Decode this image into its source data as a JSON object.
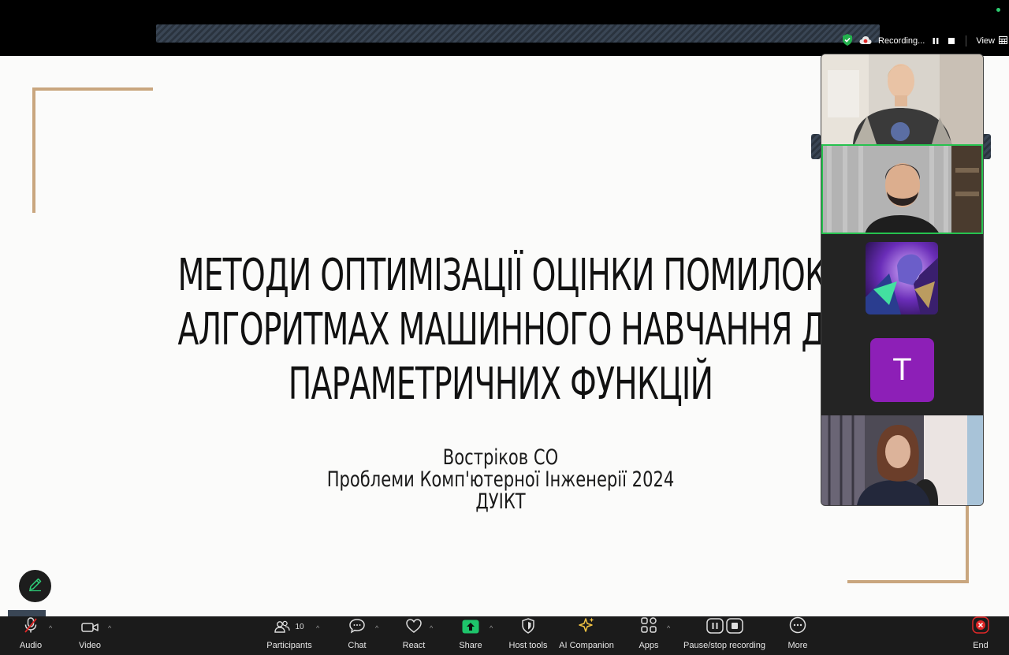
{
  "top_bar": {
    "recording_label": "Recording...",
    "view_label": "View"
  },
  "slide": {
    "title_lines": [
      "МЕТОДИ ОПТИМІЗАЦІЇ ОЦІНКИ ПОМИЛОК",
      "АЛГОРИТМАХ МАШИННОГО НАВЧАННЯ ДЛ",
      "ПАРАМЕТРИЧНИХ ФУНКЦІЙ"
    ],
    "author": "Вострiков СО",
    "conference": "Проблеми Комп'ютерної Інженерії 2024",
    "institution": "ДУІКТ",
    "accent_color": "#c9a67e"
  },
  "participants_panel": {
    "tiles": [
      {
        "type": "video",
        "icon": "participant-video-woman",
        "active": false
      },
      {
        "type": "video",
        "icon": "participant-video-man",
        "active": true
      },
      {
        "type": "avatar-image",
        "icon": "anime-avatar",
        "active": false
      },
      {
        "type": "initial",
        "initial": "T",
        "color": "#8d1fb7",
        "active": false
      },
      {
        "type": "video",
        "icon": "participant-video-woman-2",
        "active": false
      }
    ]
  },
  "toolbar": {
    "audio_label": "Audio",
    "video_label": "Video",
    "participants_label": "Participants",
    "participants_count": "10",
    "chat_label": "Chat",
    "react_label": "React",
    "share_label": "Share",
    "host_tools_label": "Host tools",
    "ai_companion_label": "AI Companion",
    "apps_label": "Apps",
    "recording_label": "Pause/stop recording",
    "more_label": "More",
    "end_label": "End",
    "share_color": "#1ec46b",
    "end_color": "#e02828"
  }
}
